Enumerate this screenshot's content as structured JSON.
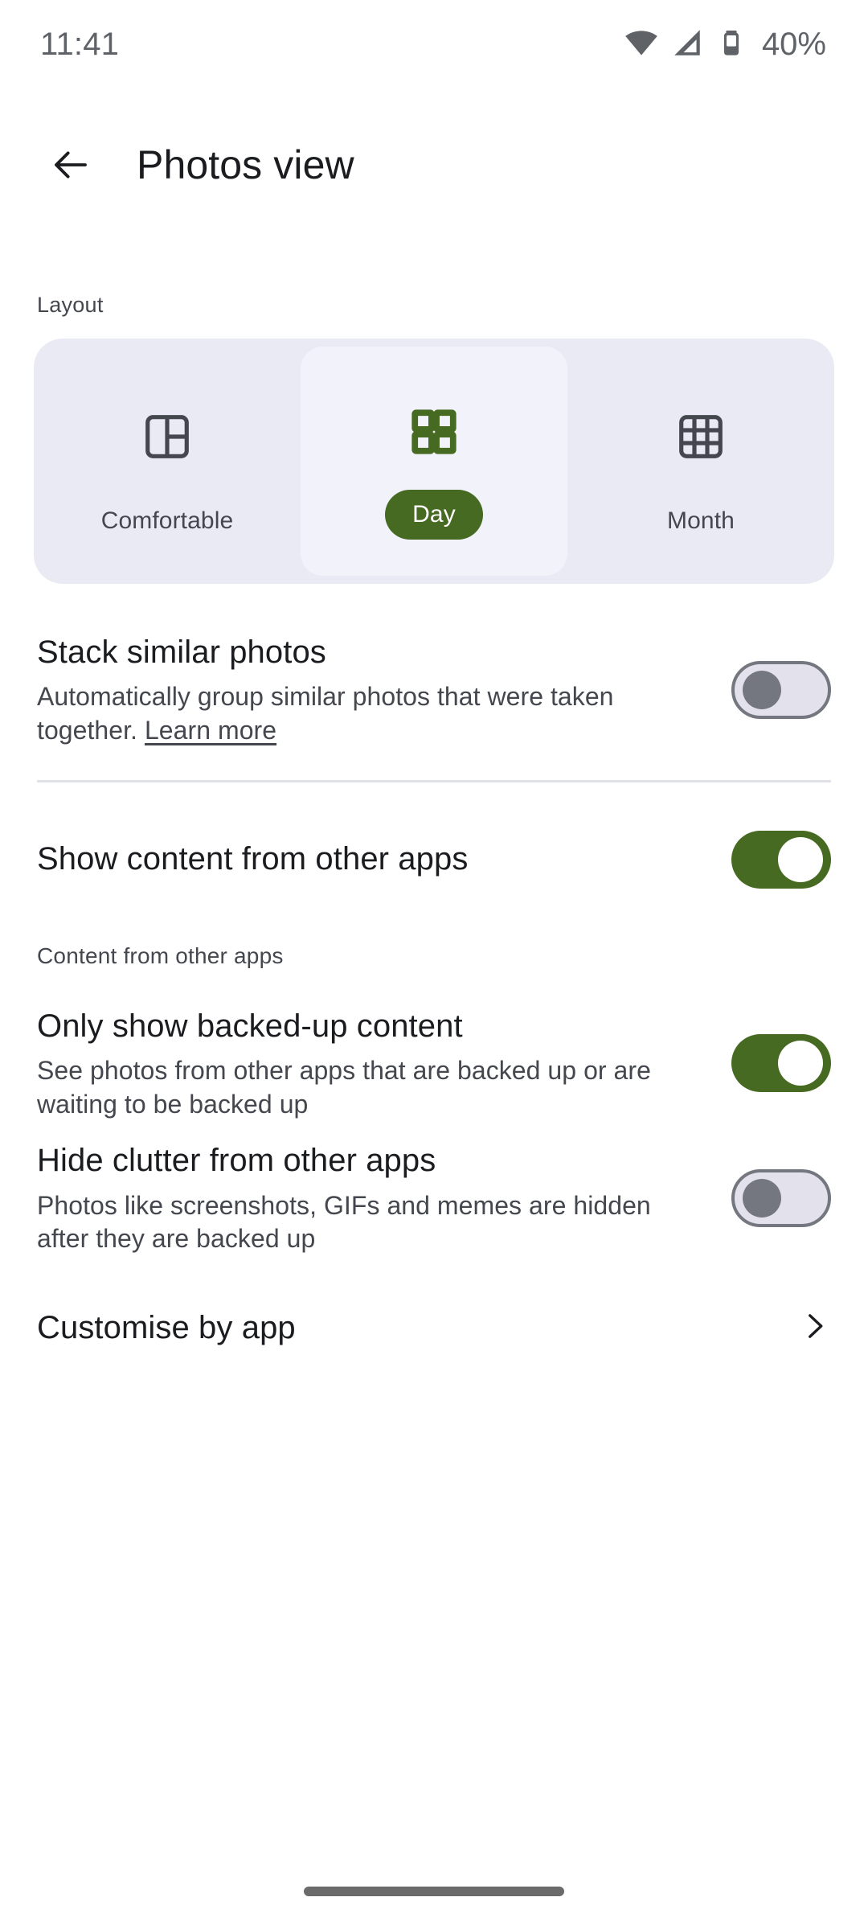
{
  "status_bar": {
    "time": "11:41",
    "battery_percent": "40%",
    "icons": [
      "wifi-icon",
      "cellular-signal-icon",
      "battery-icon"
    ]
  },
  "app_bar": {
    "back_icon": "back-arrow-icon",
    "title": "Photos view"
  },
  "layout_section": {
    "label": "Layout",
    "options": [
      {
        "label": "Comfortable",
        "icon": "comfortable-layout-icon",
        "selected": false
      },
      {
        "label": "Day",
        "icon": "day-grid-icon",
        "selected": true
      },
      {
        "label": "Month",
        "icon": "month-grid-icon",
        "selected": false
      }
    ]
  },
  "settings": {
    "stack_similar_photos": {
      "title": "Stack similar photos",
      "description": "Automatically group similar photos that were taken together.",
      "learn_more": "Learn more",
      "toggle_state": "off"
    },
    "show_content_other_apps": {
      "title": "Show content from other apps",
      "toggle_state": "on"
    },
    "content_section_header": "Content from other apps",
    "only_backed_up": {
      "title": "Only show backed-up content",
      "description": "See photos from other apps that are backed up or are waiting to be backed up",
      "toggle_state": "on"
    },
    "hide_clutter": {
      "title": "Hide clutter from other apps",
      "description": "Photos like screenshots, GIFs and memes are hidden after they are backed up",
      "toggle_state": "off"
    },
    "customise_by_app": {
      "label": "Customise by app",
      "chevron_icon": "chevron-right-icon"
    }
  },
  "nav_bar": {
    "gesture_pill": "home-gesture-pill"
  },
  "colors": {
    "accent_green": "#476a22",
    "card_background": "#eaeaf4",
    "selected_tile": "#f2f2fa",
    "title_text": "#1b1c1f",
    "secondary_text": "#44474e",
    "toggle_off_track": "#e3e2ec",
    "toggle_off_outline": "#74777f"
  }
}
